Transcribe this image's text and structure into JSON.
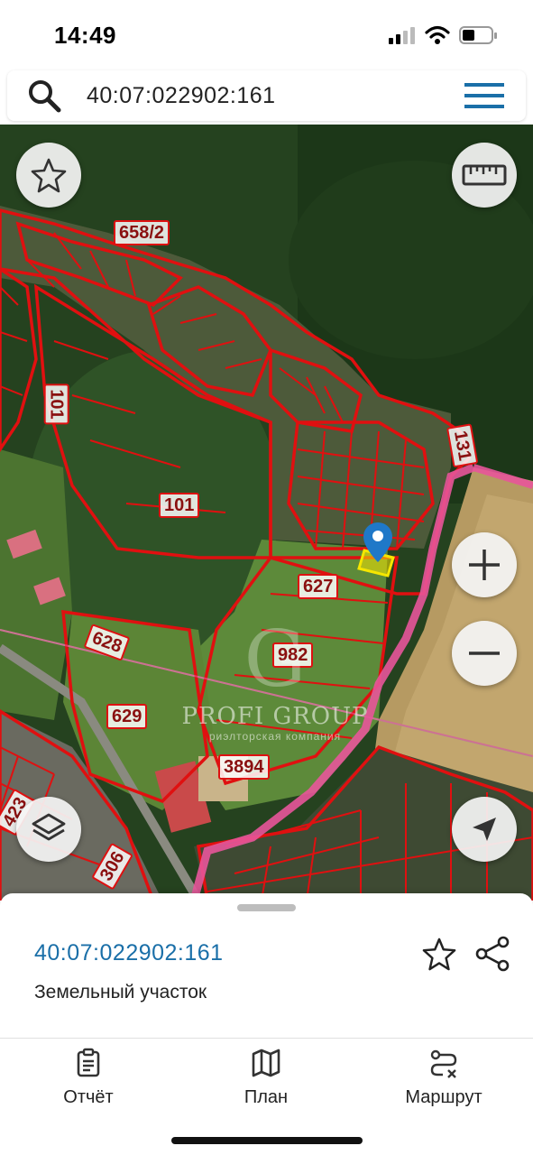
{
  "status_bar": {
    "time": "14:49"
  },
  "search": {
    "query": "40:07:022902:161"
  },
  "map": {
    "plot_labels": [
      "658/2",
      "101",
      "101",
      "131",
      "627",
      "628",
      "982",
      "629",
      "3894",
      "423",
      "306"
    ],
    "watermark": {
      "brand": "PROFI GROUP",
      "tagline": "риэлторская компания"
    },
    "colors": {
      "boundary": "#e01010",
      "selected_plot": "#f5e600",
      "marker": "#1f78c8",
      "district_edge": "#e8559a"
    }
  },
  "sheet": {
    "cadastral_number": "40:07:022902:161",
    "object_type": "Земельный участок"
  },
  "nav": {
    "report": "Отчёт",
    "plan": "План",
    "route": "Маршрут"
  },
  "icons": [
    "search-icon",
    "menu-icon",
    "star-icon",
    "ruler-icon",
    "zoom-in-icon",
    "zoom-out-icon",
    "layers-icon",
    "locate-icon",
    "share-icon",
    "report-icon",
    "plan-icon",
    "route-icon",
    "map-marker-icon"
  ]
}
